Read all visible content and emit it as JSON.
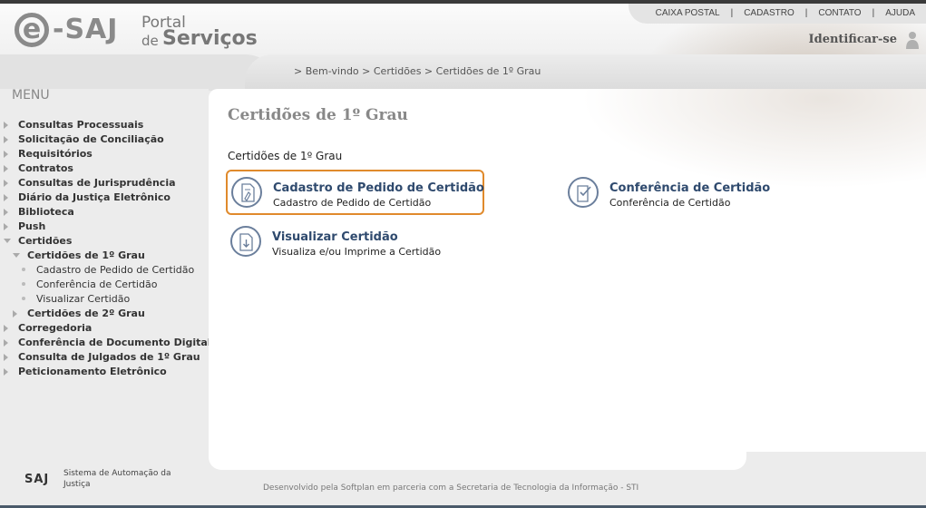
{
  "header": {
    "logo_saj": "-SAJ",
    "logo_portal": "Portal",
    "logo_de": "de",
    "logo_servicos": "Serviços",
    "top_links": [
      "CAIXA POSTAL",
      "CADASTRO",
      "CONTATO",
      "AJUDA"
    ],
    "identify": "Identificar-se"
  },
  "breadcrumb": "> Bem-vindo > Certidões > Certidões de 1º Grau",
  "menu": {
    "title": "MENU",
    "items": [
      "Consultas Processuais",
      "Solicitação de Conciliação",
      "Requisitórios",
      "Contratos",
      "Consultas de Jurisprudência",
      "Diário da Justiça Eletrônico",
      "Biblioteca",
      "Push",
      "Certidões",
      "Certidões de 1º Grau",
      "Cadastro de Pedido de Certidão",
      "Conferência de Certidão",
      "Visualizar Certidão",
      "Certidões de 2º Grau",
      "Corregedoria",
      "Conferência de Documento Digital",
      "Consulta de Julgados de 1º Grau",
      "Peticionamento Eletrônico"
    ]
  },
  "main": {
    "title": "Certidões de 1º Grau",
    "section_label": "Certidões de 1º Grau",
    "options": [
      {
        "title": "Cadastro de Pedido de Certidão",
        "subtitle": "Cadastro de Pedido de Certidão"
      },
      {
        "title": "Conferência de Certidão",
        "subtitle": "Conferência de Certidão"
      },
      {
        "title": "Visualizar Certidão",
        "subtitle": "Visualiza e/ou Imprime a Certidão"
      }
    ]
  },
  "footer": {
    "logo": "SAJ",
    "system_name": "Sistema de Automação da Justiça",
    "developed_by": "Desenvolvido pela Softplan em parceria com a Secretaria de Tecnologia da Informação - STI"
  },
  "colors": {
    "highlight": "#e08a2c",
    "option_title": "#2f4a6e",
    "icon_ring": "#6b7f9c"
  },
  "icons": {
    "cadastro": "document-stamp-icon",
    "conferencia": "document-check-icon",
    "visualizar": "document-download-icon",
    "user": "person-icon"
  }
}
